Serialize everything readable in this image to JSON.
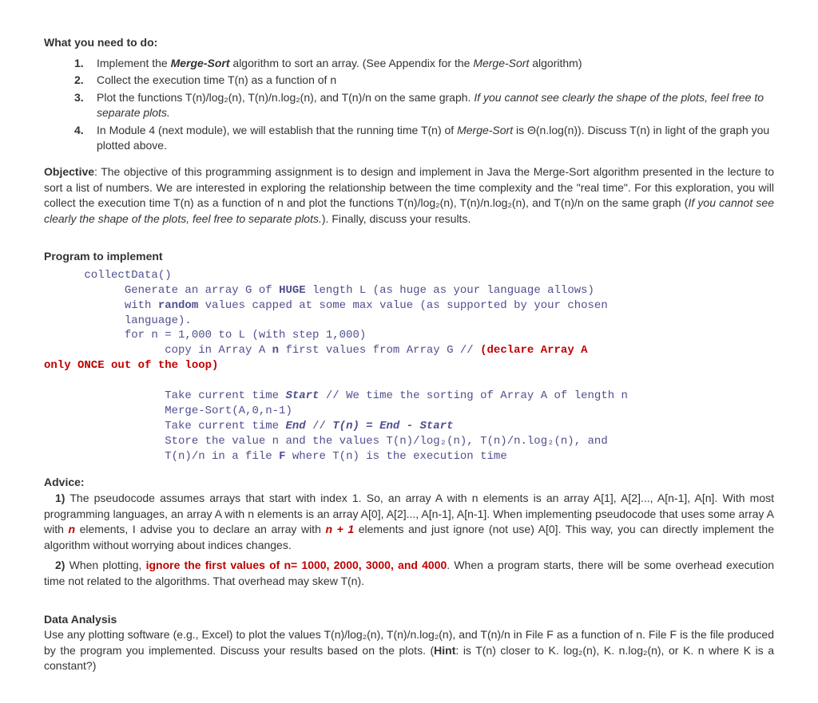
{
  "heading1": "What you need to do:",
  "list": {
    "n1": "1.",
    "n2": "2.",
    "n3": "3.",
    "n4": "4.",
    "i1a": "Implement the ",
    "i1b": "Merge-Sort",
    "i1c": " algorithm to sort an array. (See Appendix for the ",
    "i1d": "Merge-Sort",
    "i1e": " algorithm)",
    "i2": "Collect the execution time T(n) as a function of n",
    "i3a": "Plot the functions T(n)/log₂(n), T(n)/n.log₂(n), and T(n)/n on the same graph. ",
    "i3b": "If you cannot see clearly the shape of the plots, feel free to separate plots.",
    "i4a": "In Module 4 (next module), we will establish that the running time T(n) of ",
    "i4b": "Merge-Sort",
    "i4c": " is  Θ(n.log(n)). Discuss T(n) in light of the graph you plotted above."
  },
  "objective": {
    "label": "Objective",
    "t1": ": The objective of this programming assignment is to design and implement in Java the Merge-Sort algorithm presented in the lecture to sort a list of numbers. We are interested in exploring the relationship between the time complexity and the \"real time\". For this exploration, you will collect the execution time T(n) as a function of n and plot the functions T(n)/log₂(n), T(n)/n.log₂(n), and T(n)/n on the same graph (",
    "t2": "If you cannot see clearly the shape of the plots, feel free to separate plots.",
    "t3": "). Finally, discuss your results."
  },
  "program_heading": "Program to implement",
  "code": {
    "l1": "      collectData()",
    "l2a": "            Generate an array G of ",
    "l2b": "HUGE",
    "l2c": " length L (as huge as your language allows)",
    "l3a": "            with ",
    "l3b": "random",
    "l3c": " values capped at some max value (as supported by your chosen",
    "l4": "            language).",
    "l5": "            for n = 1,000 to L (with step 1,000)",
    "l6a": "                  copy in Array A ",
    "l6b": "n",
    "l6c": " first values from Array G // ",
    "l6d": "(declare Array A",
    "l7": "only ONCE out of the loop)",
    "gap": "",
    "l8a": "                  Take current time ",
    "l8b": "Start",
    "l8c": " // We time the sorting of Array A of length n",
    "l9": "                  Merge-Sort(A,0,n-1)",
    "l10a": "                  Take current time ",
    "l10b": "End",
    "l10c": " // ",
    "l10d": "T(n) = End - Start",
    "l11": "                  Store the value n and the values T(n)/log₂(n), T(n)/n.log₂(n), and",
    "l12a": "                  T(n)/n in a file ",
    "l12b": "F",
    "l12c": " where T(n) is the execution time"
  },
  "advice": {
    "label": "Advice:",
    "p1a": "1)",
    "p1b": " The pseudocode assumes arrays that start with index 1. So, an array A with n elements is an array A[1], A[2]..., A[n-1], A[n]. With most programming languages, an array A with n elements is an array A[0], A[2]..., A[n-1], A[n-1]. When implementing pseudocode that uses some array A with ",
    "p1c": "n",
    "p1d": " elements, I advise you to declare an array with ",
    "p1e": "n + 1",
    "p1f": " elements and just ignore (not use) A[0]. This way, you can directly implement the algorithm without worrying about indices changes.",
    "p2a": "2)",
    "p2b": " When plotting, ",
    "p2c": "ignore the first values of n= 1000, 2000, 3000, and 4000",
    "p2d": ". When a program starts, there will be some overhead execution time not related to the algorithms. That overhead may skew T(n)."
  },
  "data_analysis": {
    "label": "Data Analysis",
    "t1": "Use any plotting software (e.g., Excel) to plot the values T(n)/log₂(n), T(n)/n.log₂(n), and T(n)/n in File F as a function of n. File F is the file produced by the program you implemented.  Discuss your results based on the plots. (",
    "t2": "Hint",
    "t3": ": is T(n) closer to K. log₂(n), K. n.log₂(n), or K. n where K is a constant?)"
  }
}
